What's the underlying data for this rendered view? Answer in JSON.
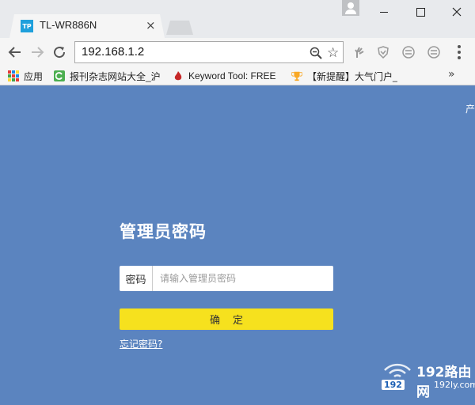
{
  "colors": {
    "page_bg": "#5b84bf",
    "confirm_button": "#f6e11e",
    "favicon": "#1fa0dc"
  },
  "tab": {
    "favicon_text": "TP",
    "title": "TL-WR886N",
    "close": "×",
    "favicon_icon": "tp-link-icon"
  },
  "toolbar": {
    "url": "192.168.1.2",
    "star": "☆"
  },
  "bookmarks": {
    "items": [
      {
        "label": "应用",
        "icon": "apps-icon"
      },
      {
        "label": "报刊杂志网站大全_沪",
        "icon": "refresh-c-icon"
      },
      {
        "label": "Keyword Tool: FREE",
        "icon": "flame-icon"
      },
      {
        "label": "【新提醒】大气门户_",
        "icon": "trophy-icon"
      }
    ],
    "more": "»"
  },
  "page": {
    "corner_text": "产",
    "title": "管理员密码",
    "password_label": "密码",
    "password_placeholder": "请输入管理员密码",
    "password_value": "",
    "confirm_label": "确定",
    "forgot_link": "忘记密码?"
  },
  "watermark": {
    "brand": "192路由网",
    "badge": "192",
    "url": "192ly.com"
  }
}
